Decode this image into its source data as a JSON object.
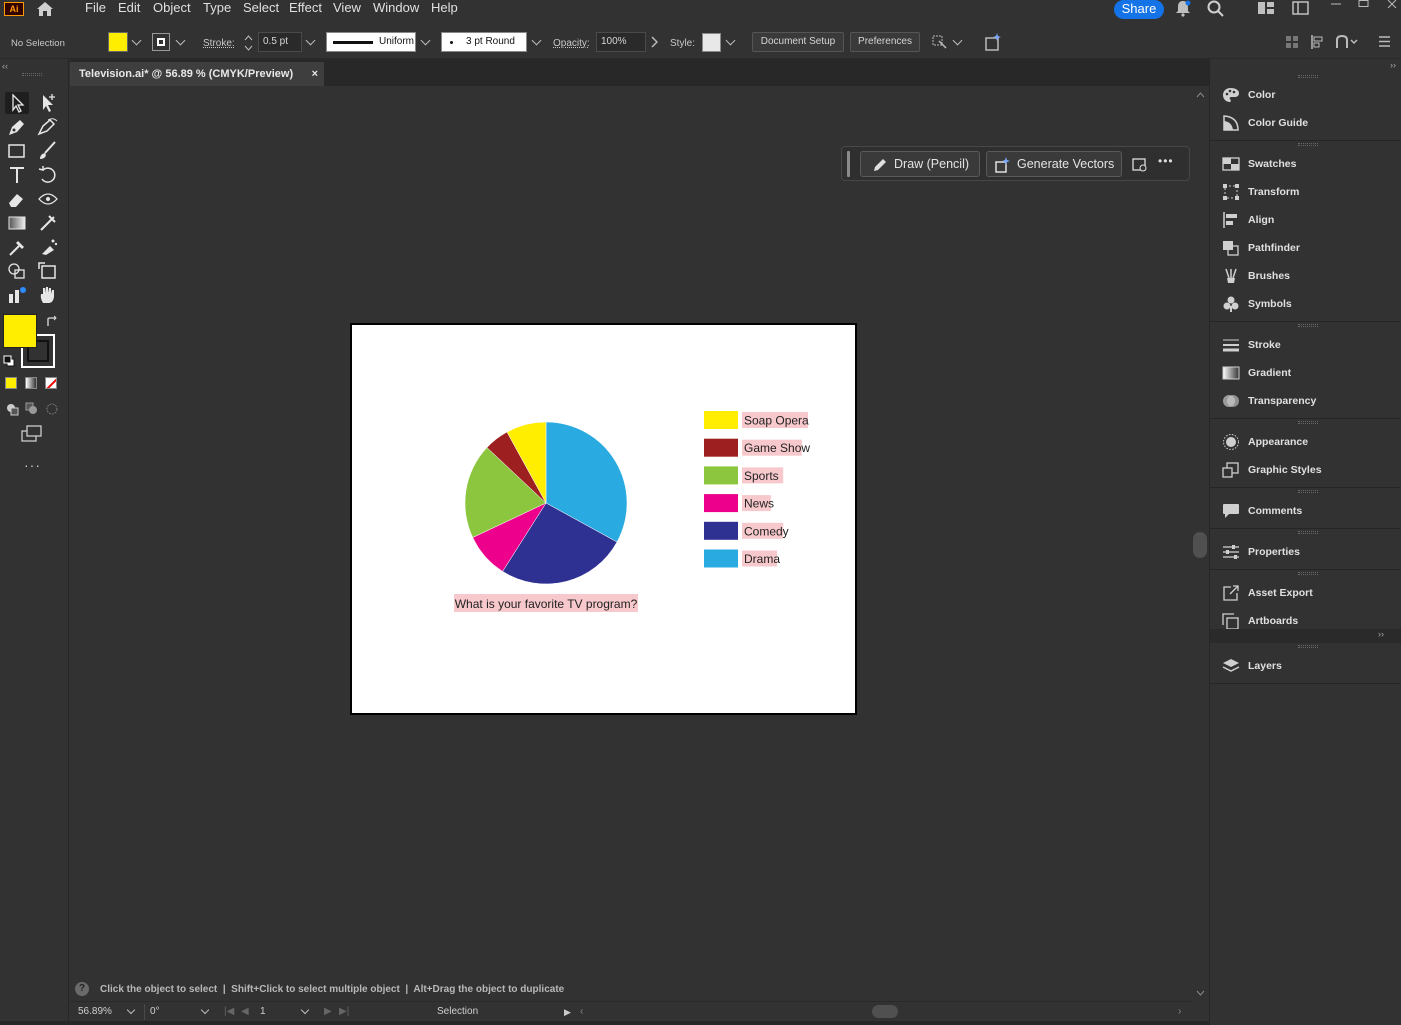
{
  "app": {
    "logo": "Ai"
  },
  "menu": {
    "items": [
      "File",
      "Edit",
      "Object",
      "Type",
      "Select",
      "Effect",
      "View",
      "Window",
      "Help"
    ],
    "share_label": "Share"
  },
  "control_bar": {
    "selection_status": "No Selection",
    "fill_color": "#ffee00",
    "stroke_label": "Stroke:",
    "stroke_weight": "0.5 pt",
    "stroke_profile": "Uniform",
    "brush": "3 pt Round",
    "opacity_label": "Opacity:",
    "opacity_value": "100%",
    "style_label": "Style:",
    "document_setup": "Document Setup",
    "preferences": "Preferences"
  },
  "document": {
    "tab_title": "Television.ai* @ 56.89 % (CMYK/Preview)",
    "close_glyph": "×"
  },
  "context_bar": {
    "draw_label": "Draw (Pencil)",
    "generate_label": "Generate Vectors",
    "more_glyph": "•••"
  },
  "chart_data": {
    "type": "pie",
    "title": "What is your favorite TV program?",
    "categories": [
      "Drama",
      "Comedy",
      "News",
      "Sports",
      "Game Show",
      "Soap Opera"
    ],
    "values": [
      33,
      26,
      9,
      19,
      5,
      8
    ],
    "colors": [
      "#29abe2",
      "#2e3192",
      "#ec008c",
      "#8cc63f",
      "#9e1f1f",
      "#ffee00"
    ],
    "legend": [
      "Soap Opera",
      "Game Show",
      "Sports",
      "News",
      "Comedy",
      "Drama"
    ],
    "legend_colors": [
      "#ffee00",
      "#9e1f1f",
      "#8cc63f",
      "#ec008c",
      "#2e3192",
      "#29abe2"
    ],
    "legend_placement": "right"
  },
  "status_bar": {
    "hint": "Click the object to select  |  Shift+Click to select multiple object  |  Alt+Drag the object to duplicate",
    "zoom": "56.89%",
    "rotation": "0°",
    "artboard_number": "1",
    "current_tool": "Selection"
  },
  "panels": {
    "items": [
      "Color",
      "Color Guide",
      "Swatches",
      "Transform",
      "Align",
      "Pathfinder",
      "Brushes",
      "Symbols",
      "Stroke",
      "Gradient",
      "Transparency",
      "Appearance",
      "Graphic Styles",
      "Comments",
      "Properties",
      "Asset Export",
      "Artboards",
      "Layers"
    ]
  }
}
